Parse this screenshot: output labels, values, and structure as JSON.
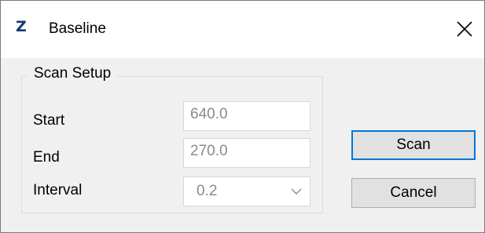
{
  "window": {
    "app_icon_text": "Z",
    "title": "Baseline"
  },
  "scan_setup": {
    "group_label": "Scan Setup",
    "start_label": "Start",
    "start_value": "640.0",
    "end_label": "End",
    "end_value": "270.0",
    "interval_label": "Interval",
    "interval_value": "0.2"
  },
  "buttons": {
    "scan": "Scan",
    "cancel": "Cancel"
  },
  "icons": {
    "close": "close-icon",
    "chevron": "chevron-down-icon"
  },
  "colors": {
    "accent": "#0078d7",
    "app_icon": "#0b3b6e"
  }
}
